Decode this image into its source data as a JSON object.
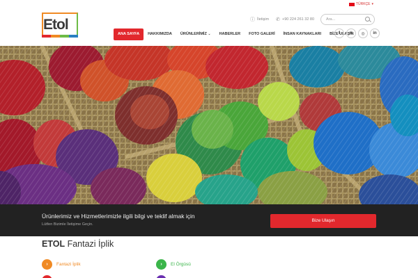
{
  "brand": {
    "logo_text": "Etol",
    "stripe_colors": [
      "#e2282d",
      "#f08a24",
      "#6dbb45",
      "#2a7fc0"
    ]
  },
  "topbar": {
    "language": "TÜRKÇE",
    "contact_label": "İletişim",
    "phone": "+90 224 261 32 80",
    "search_placeholder": "Ara..."
  },
  "nav": {
    "items": [
      {
        "label": "ANA SAYFA",
        "active": true
      },
      {
        "label": "HAKKIMIZDA"
      },
      {
        "label": "ÜRÜNLERİMİZ",
        "has_dropdown": true
      },
      {
        "label": "HABERLER"
      },
      {
        "label": "FOTO GALERİ"
      },
      {
        "label": "İNSAN KAYNAKLARI"
      },
      {
        "label": "BİZE ULAŞIN"
      }
    ]
  },
  "social": [
    "facebook-icon",
    "pinterest-icon",
    "instagram-icon",
    "linkedin-icon"
  ],
  "cta": {
    "title": "Ürünlerimiz ve Hizmetlerimizle ilgili bilgi ve teklif almak için",
    "subtitle": "Lütfen Bizimle İletişime Geçin.",
    "button": "Bize Ulaşın"
  },
  "section": {
    "title_bold": "ETOL",
    "title_rest": "Fantazi İplik"
  },
  "features": [
    {
      "label": "Fantazi İplik",
      "color": "#f08a24",
      "text_color": "#f08a24"
    },
    {
      "label": "El Örgüsü",
      "color": "#3bb54a",
      "text_color": "#3bb54a"
    }
  ],
  "colors": {
    "accent": "#e2282d",
    "dark_band": "#222222"
  }
}
